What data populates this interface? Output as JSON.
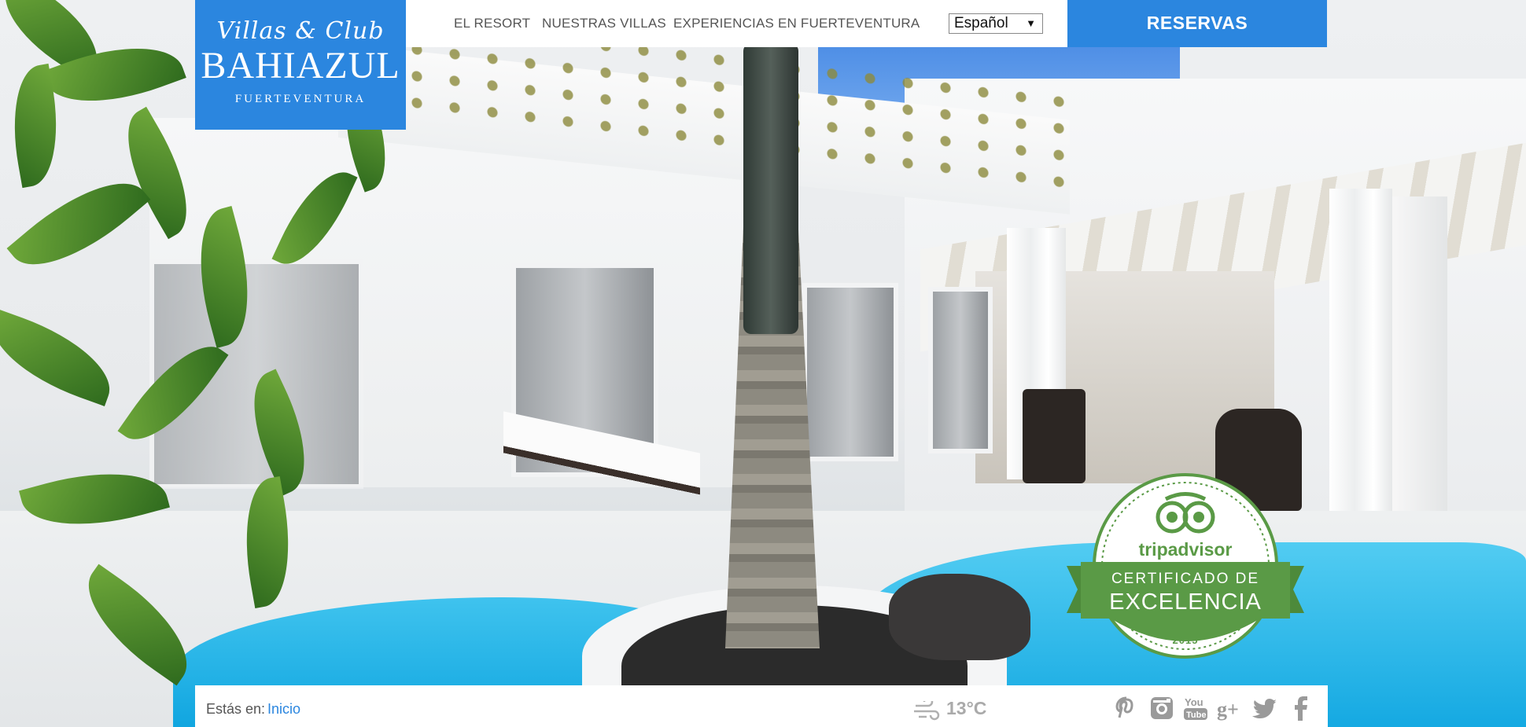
{
  "logo": {
    "script": "Villas & Club",
    "name": "BAHIAZUL",
    "place": "FUERTEVENTURA"
  },
  "nav": {
    "items": [
      "EL RESORT",
      "NUESTRAS VILLAS",
      "EXPERIENCIAS EN FUERTEVENTURA"
    ],
    "language": "Español",
    "reservas": "RESERVAS"
  },
  "badge": {
    "brand": "tripadvisor",
    "line1": "CERTIFICADO DE",
    "line2": "EXCELENCIA",
    "year": "2015"
  },
  "footer": {
    "breadcrumb_label": "Estás en:",
    "breadcrumb_link": "Inicio",
    "temperature": "13°C",
    "social": [
      "pinterest-icon",
      "instagram-icon",
      "youtube-icon",
      "google-plus-icon",
      "twitter-icon",
      "facebook-icon"
    ]
  },
  "colors": {
    "accent": "#2b86df",
    "badge_green": "#5a9a46"
  }
}
